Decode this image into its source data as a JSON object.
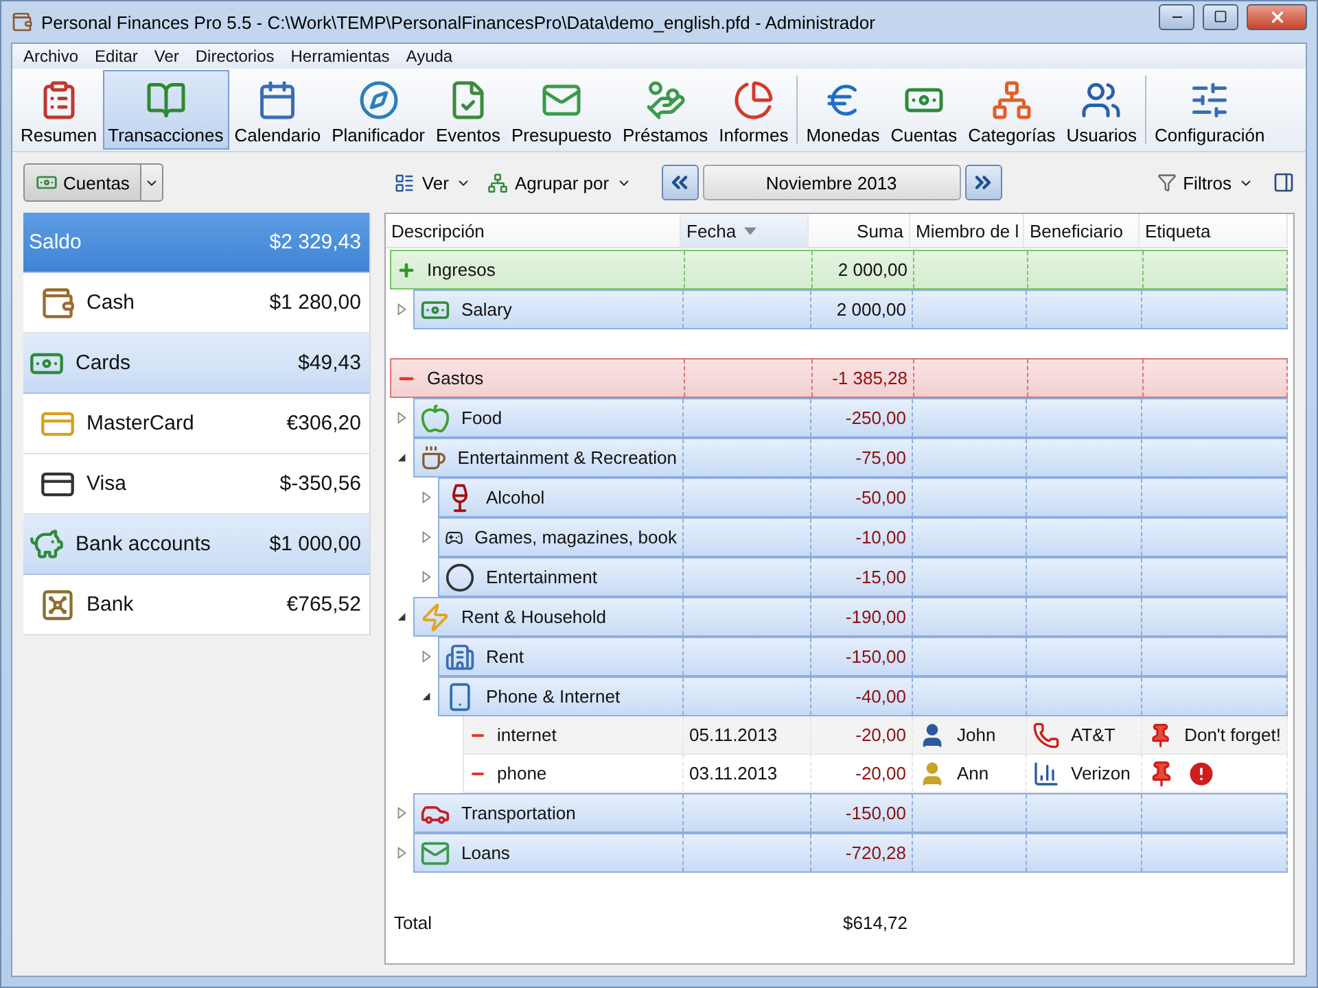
{
  "window": {
    "title": "Personal Finances Pro 5.5 - C:\\Work\\TEMP\\PersonalFinancesPro\\Data\\demo_english.pfd - Administrador"
  },
  "menu": [
    "Archivo",
    "Editar",
    "Ver",
    "Directorios",
    "Herramientas",
    "Ayuda"
  ],
  "toolbar": [
    [
      {
        "label": "Resumen",
        "selected": false
      },
      {
        "label": "Transacciones",
        "selected": true
      },
      {
        "label": "Calendario",
        "selected": false
      },
      {
        "label": "Planificador",
        "selected": false
      },
      {
        "label": "Eventos",
        "selected": false
      },
      {
        "label": "Presupuesto",
        "selected": false
      },
      {
        "label": "Préstamos",
        "selected": false
      },
      {
        "label": "Informes",
        "selected": false
      }
    ],
    [
      {
        "label": "Monedas",
        "selected": false
      },
      {
        "label": "Cuentas",
        "selected": false
      },
      {
        "label": "Categorías",
        "selected": false
      },
      {
        "label": "Usuarios",
        "selected": false
      }
    ],
    [
      {
        "label": "Configuración",
        "selected": false
      }
    ]
  ],
  "view_bar": {
    "accounts_button": "Cuentas",
    "view_menu": "Ver",
    "group_menu": "Agrupar por",
    "period": "Noviembre 2013",
    "filters": "Filtros"
  },
  "accounts": [
    {
      "kind": "group",
      "name": "Saldo",
      "amount": "$2 329,43",
      "selected": true
    },
    {
      "kind": "account",
      "name": "Cash",
      "amount": "$1 280,00",
      "selected": false
    },
    {
      "kind": "group",
      "name": "Cards",
      "amount": "$49,43",
      "selected": false
    },
    {
      "kind": "account",
      "name": "MasterCard",
      "amount": "€306,20",
      "selected": false
    },
    {
      "kind": "account",
      "name": "Visa",
      "amount": "$-350,56",
      "selected": false
    },
    {
      "kind": "group",
      "name": "Bank accounts",
      "amount": "$1 000,00",
      "selected": false
    },
    {
      "kind": "account",
      "name": "Bank",
      "amount": "€765,52",
      "selected": false
    }
  ],
  "grid": {
    "columns": [
      {
        "label": "Descripción",
        "sorted": false
      },
      {
        "label": "Fecha",
        "sorted": true
      },
      {
        "label": "Suma",
        "sorted": false
      },
      {
        "label": "Miembro de l",
        "sorted": false
      },
      {
        "label": "Beneficiario",
        "sorted": false
      },
      {
        "label": "Etiqueta",
        "sorted": false
      }
    ],
    "sections": [
      {
        "kind": "income",
        "name": "Ingresos",
        "amount": "2 000,00",
        "children": [
          {
            "kind": "category",
            "name": "Salary",
            "amount": "2 000,00",
            "expanded": false
          }
        ]
      },
      {
        "kind": "expense",
        "name": "Gastos",
        "amount": "-1 385,28",
        "children": [
          {
            "kind": "category",
            "name": "Food",
            "amount": "-250,00",
            "expanded": false
          },
          {
            "kind": "category",
            "name": "Entertainment & Recreation",
            "amount": "-75,00",
            "expanded": true,
            "children": [
              {
                "kind": "category",
                "name": "Alcohol",
                "amount": "-50,00",
                "expanded": false
              },
              {
                "kind": "category",
                "name": "Games, magazines, book",
                "amount": "-10,00",
                "expanded": false
              },
              {
                "kind": "category",
                "name": "Entertainment",
                "amount": "-15,00",
                "expanded": false
              }
            ]
          },
          {
            "kind": "category",
            "name": "Rent & Household",
            "amount": "-190,00",
            "expanded": true,
            "children": [
              {
                "kind": "category",
                "name": "Rent",
                "amount": "-150,00",
                "expanded": false
              },
              {
                "kind": "category",
                "name": "Phone & Internet",
                "amount": "-40,00",
                "expanded": true,
                "children": [
                  {
                    "kind": "transaction",
                    "name": "internet",
                    "date": "05.11.2013",
                    "amount": "-20,00",
                    "member": "John",
                    "payee": "AT&T",
                    "tag": "Don't forget!",
                    "alert": false
                  },
                  {
                    "kind": "transaction",
                    "name": "phone",
                    "date": "03.11.2013",
                    "amount": "-20,00",
                    "member": "Ann",
                    "payee": "Verizon",
                    "alert": true
                  }
                ]
              }
            ]
          },
          {
            "kind": "category",
            "name": "Transportation",
            "amount": "-150,00",
            "expanded": false
          },
          {
            "kind": "category",
            "name": "Loans",
            "amount": "-720,28",
            "expanded": false
          }
        ]
      }
    ],
    "total": {
      "label": "Total",
      "amount": "$614,72"
    }
  }
}
